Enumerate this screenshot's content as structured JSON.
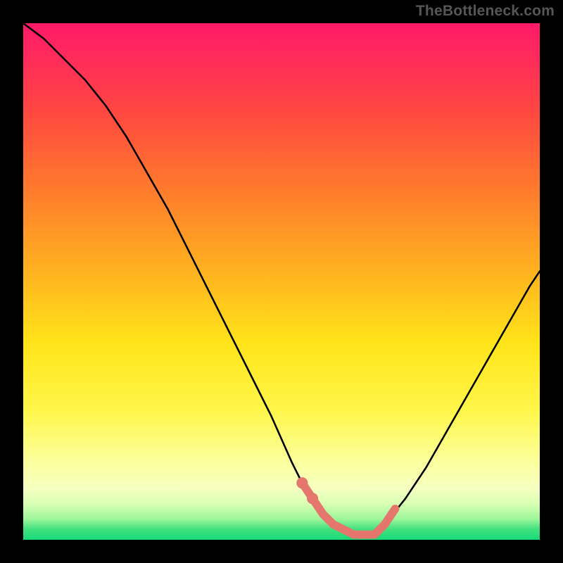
{
  "attribution": "TheBottleneck.com",
  "chart_data": {
    "type": "line",
    "title": "",
    "xlabel": "",
    "ylabel": "",
    "xlim": [
      0,
      100
    ],
    "ylim": [
      0,
      100
    ],
    "series": [
      {
        "name": "bottleneck-curve",
        "x": [
          0,
          4,
          8,
          12,
          16,
          20,
          24,
          28,
          32,
          36,
          40,
          44,
          48,
          52,
          54,
          56,
          58,
          60,
          62,
          64,
          66,
          68,
          70,
          74,
          78,
          82,
          86,
          90,
          94,
          98,
          100
        ],
        "y": [
          100,
          97,
          93,
          89,
          84,
          78,
          71,
          64,
          56,
          48,
          40,
          32,
          24,
          15,
          11,
          8,
          5,
          3,
          2,
          1,
          1,
          1,
          3,
          8,
          14,
          21,
          28,
          35,
          42,
          49,
          52
        ]
      },
      {
        "name": "highlight-segment",
        "x": [
          54,
          56,
          58,
          60,
          62,
          64,
          66,
          68,
          70,
          72
        ],
        "y": [
          11,
          8,
          5,
          3,
          2,
          1,
          1,
          1,
          3,
          6
        ]
      }
    ],
    "highlight_dots": [
      {
        "x": 54,
        "y": 11
      },
      {
        "x": 56,
        "y": 8
      }
    ],
    "background_gradient": {
      "top": "#ff1a68",
      "mid1": "#ff7a2d",
      "mid2": "#ffe41a",
      "pale": "#f6ffc0",
      "bottom": "#18d978"
    },
    "colors": {
      "curve": "#000000",
      "highlight": "#e4766e"
    }
  }
}
